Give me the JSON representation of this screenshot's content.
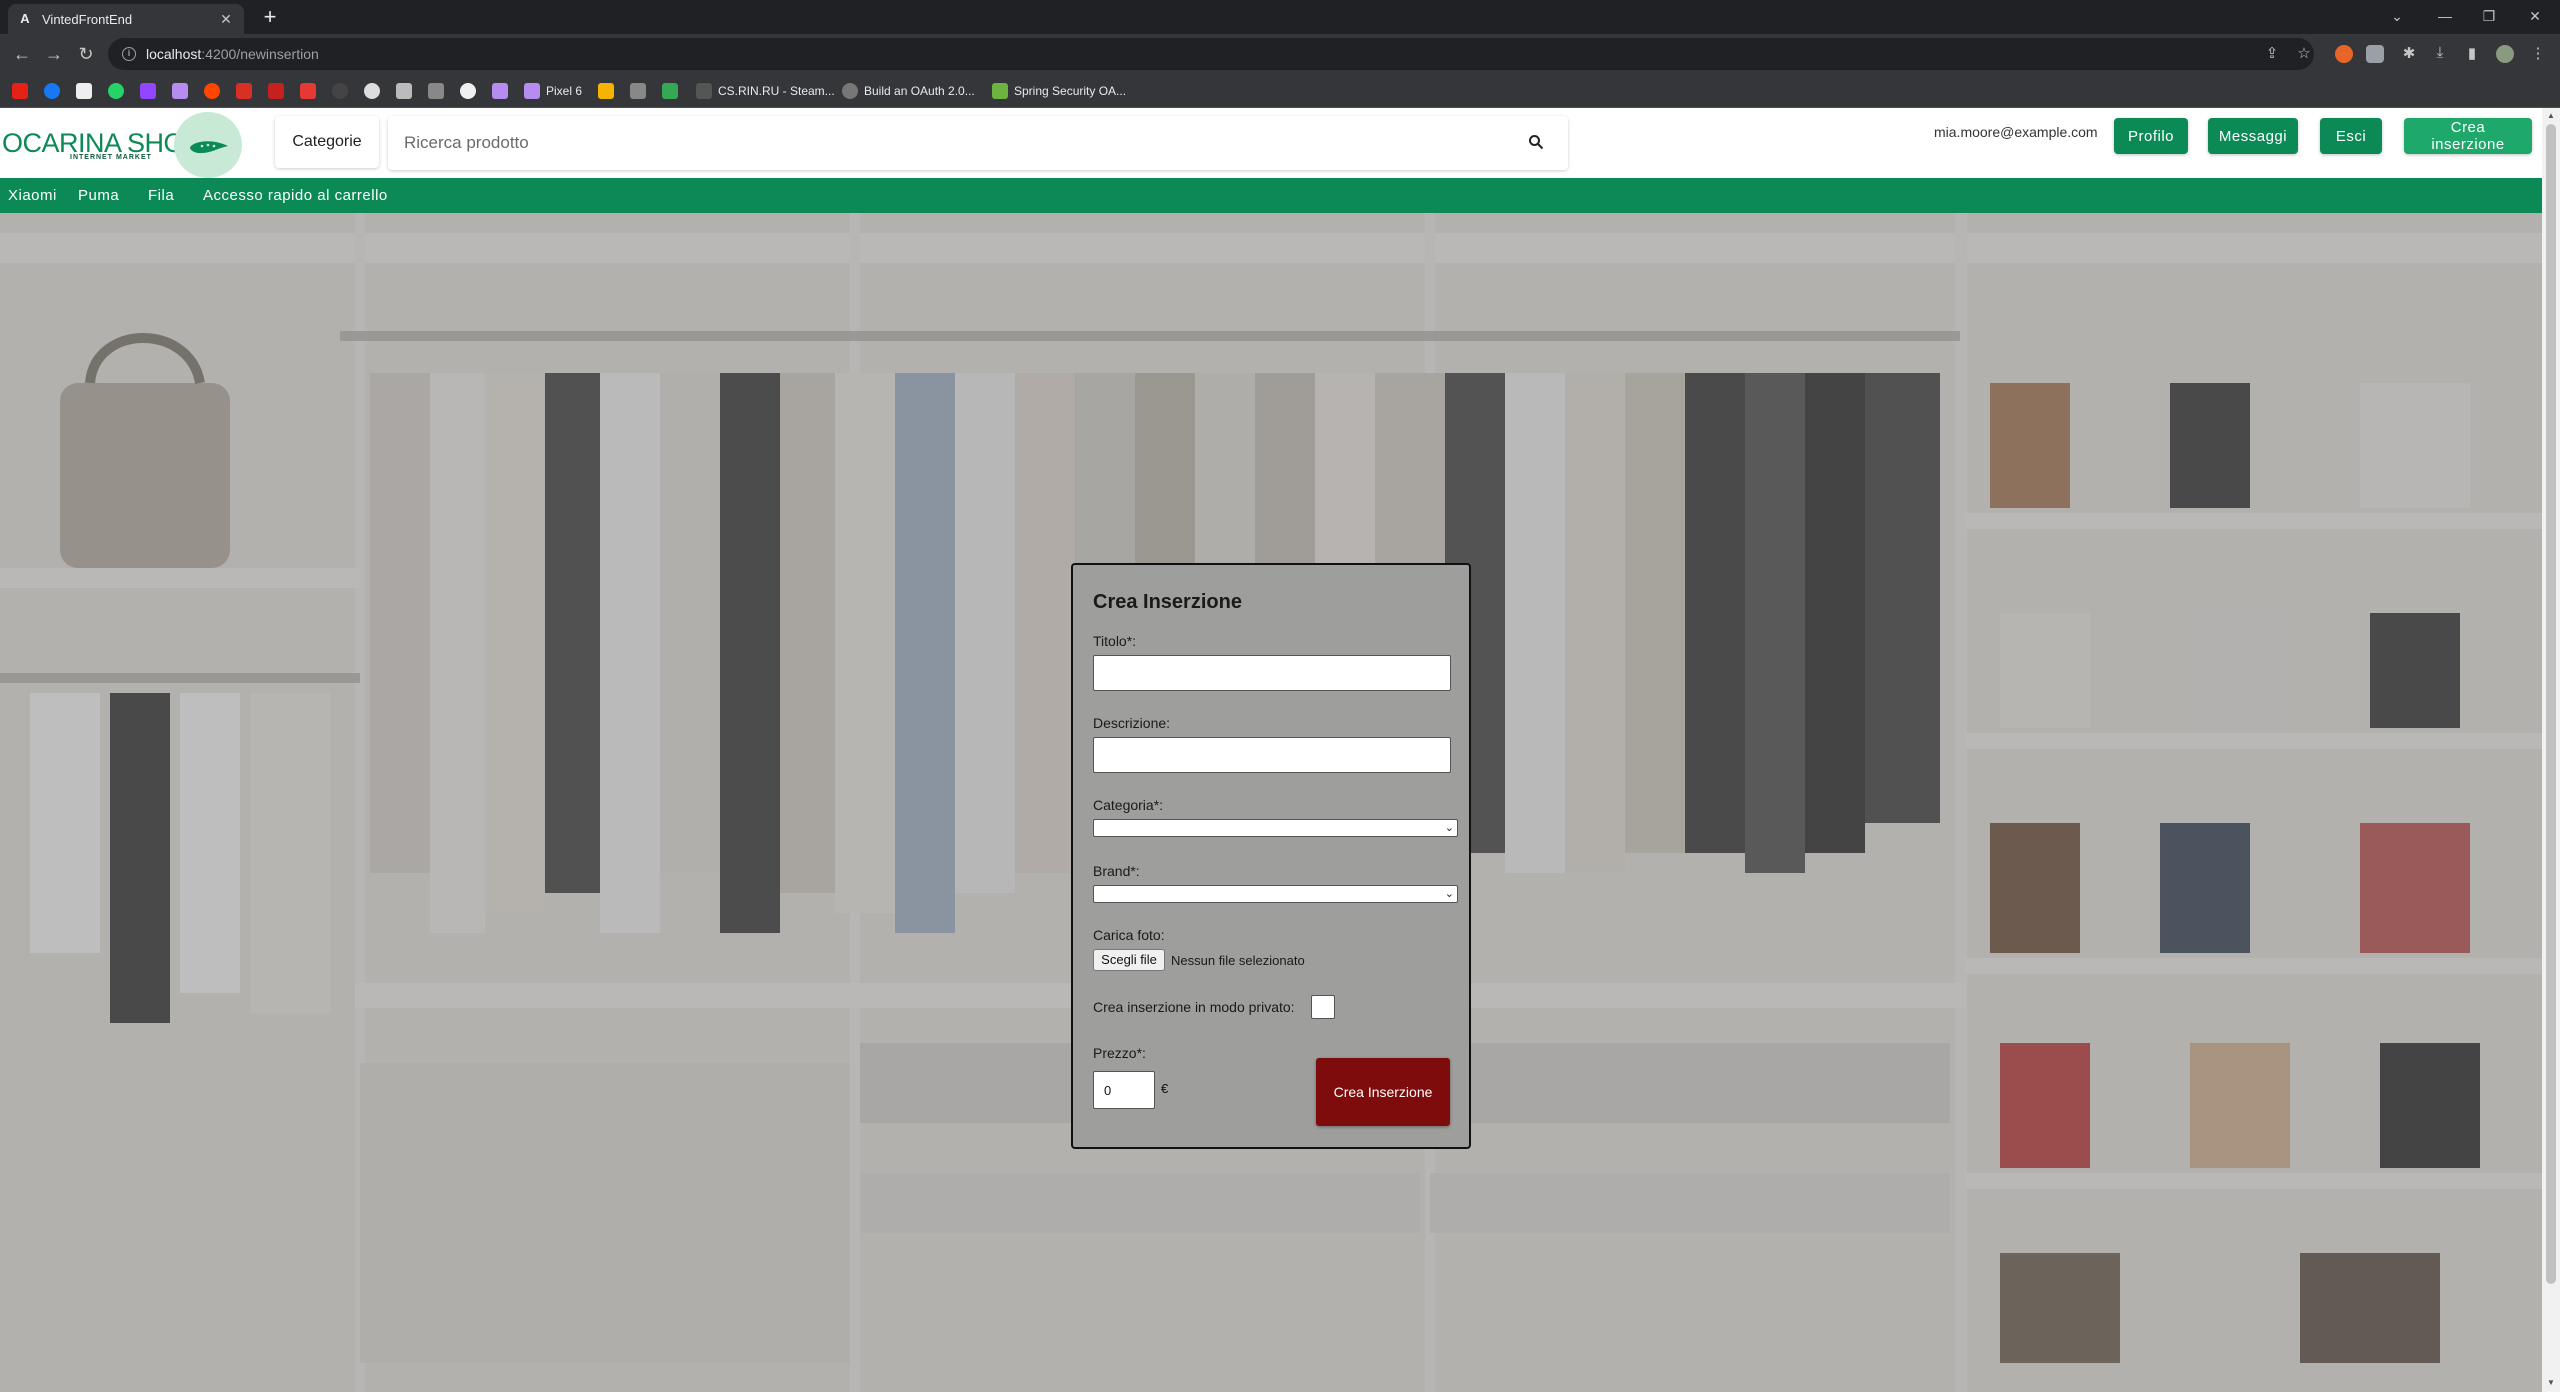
{
  "browser": {
    "tab_title": "VintedFrontEnd",
    "url_host": "localhost",
    "url_path": ":4200/newinsertion",
    "bookmarks": [
      "Pixel 6",
      "CS.RIN.RU - Steam...",
      "Build an OAuth 2.0...",
      "Spring Security OA..."
    ]
  },
  "header": {
    "logo_text": "OCARINA SHOP",
    "logo_sub": "INTERNET MARKET",
    "categories_label": "Categorie",
    "search_placeholder": "Ricerca prodotto",
    "user_email": "mia.moore@example.com",
    "profile_label": "Profilo",
    "messages_label": "Messaggi",
    "logout_label": "Esci",
    "create_label": "Crea inserzione"
  },
  "nav": {
    "links": [
      "Xiaomi",
      "Puma",
      "Fila",
      "Accesso rapido al carrello"
    ]
  },
  "form": {
    "title": "Crea Inserzione",
    "titolo_label": "Titolo*:",
    "descrizione_label": "Descrizione:",
    "categoria_label": "Categoria*:",
    "brand_label": "Brand*:",
    "foto_label": "Carica foto:",
    "file_button": "Scegli file",
    "file_status": "Nessun file selezionato",
    "private_label": "Crea inserzione in modo privato:",
    "prezzo_label": "Prezzo*:",
    "prezzo_value": "0",
    "currency": "€",
    "submit_label": "Crea Inserzione"
  },
  "colors": {
    "brand_green": "#0b8a56",
    "submit_red": "#7e0c0c"
  }
}
